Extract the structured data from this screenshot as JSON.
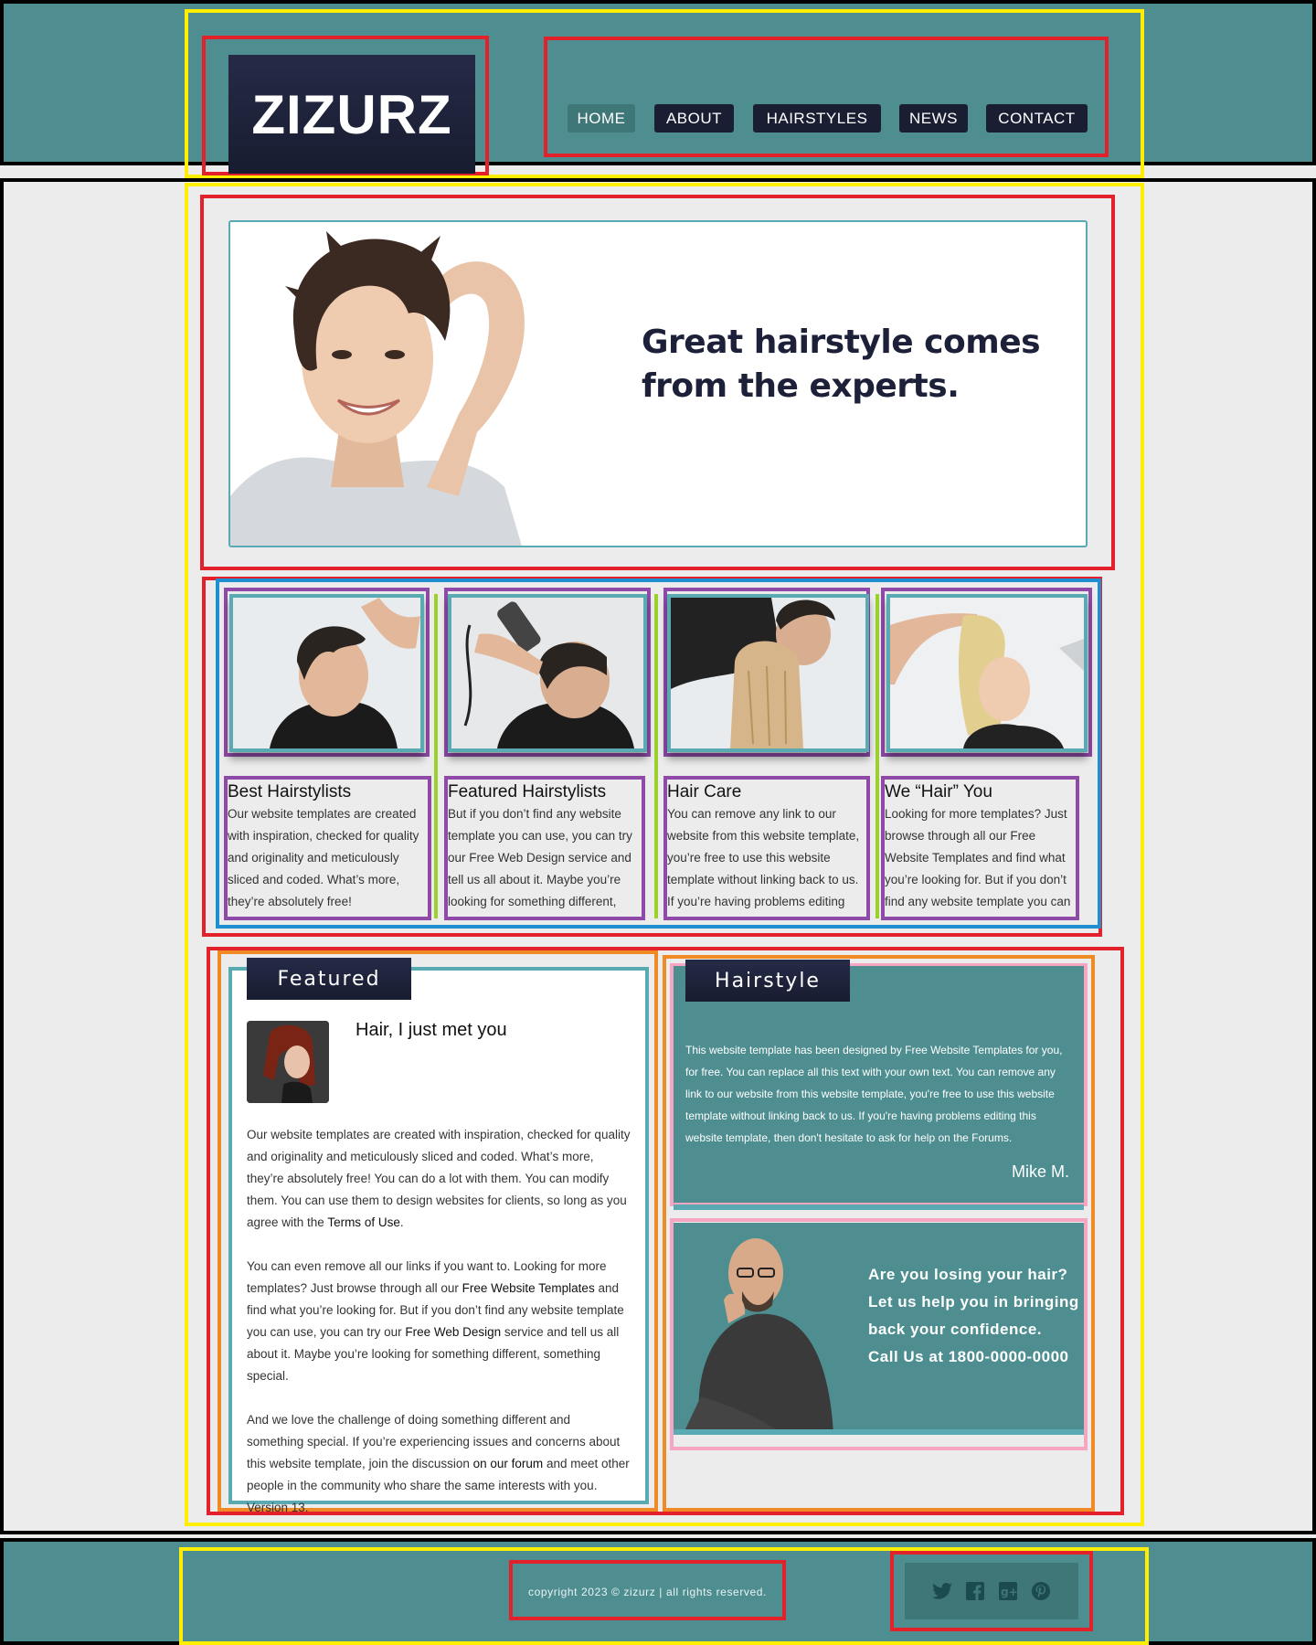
{
  "header": {
    "logo": "ZIZURZ",
    "nav": [
      {
        "label": "HOME",
        "active": true
      },
      {
        "label": "ABOUT",
        "active": false
      },
      {
        "label": "HAIRSTYLES",
        "active": false
      },
      {
        "label": "NEWS",
        "active": false
      },
      {
        "label": "CONTACT",
        "active": false
      }
    ]
  },
  "banner": {
    "headline_line1": "Great hairstyle comes",
    "headline_line2": "from the experts."
  },
  "features": [
    {
      "title": "Best Hairstylists",
      "text": "Our website templates are created with inspiration, checked for quality and originality and meticulously sliced and coded. What’s more, they’re absolutely free!"
    },
    {
      "title": "Featured Hairstylists",
      "text": "But if you don’t find any website template you can use, you can try our Free Web Design service and tell us all about it. Maybe you’re looking for something different, something"
    },
    {
      "title": "Hair Care",
      "text": "You can remove any link to our website from this website template, you’re free to use this website template without linking back to us. If you’re having problems editing this"
    },
    {
      "title": "We “Hair” You",
      "text": "Looking for more templates? Just browse through all our Free Website Templates and find what you’re looking for. But if you don’t find any website template you can use,"
    }
  ],
  "featured": {
    "tab": "Featured",
    "title": "Hair, I just met you",
    "p1_before": "Our website templates are created with inspiration, checked for quality and originality and meticulously sliced and coded. What’s more, they’re absolutely free! You can do a lot with them. You can modify them. You can use them to design websites for clients, so long as you agree with the ",
    "p1_link": "Terms of Use",
    "p1_after": ".",
    "p2_before": "You can even remove all our links if you want to. Looking for more templates? Just browse through all our ",
    "p2_link1": "Free Website Templates",
    "p2_mid": " and find what you’re looking for. But if you don’t find any website template you can use, you can try our ",
    "p2_link2": "Free Web Design",
    "p2_after": " service and tell us all about it. Maybe you’re looking for something different, something special.",
    "p3_before": "And we love the challenge of doing something different and something special. If you’re experiencing issues and concerns about this website template, join the discussion ",
    "p3_link": "on our forum",
    "p3_after": " and meet other people in the community who share the same interests with you. Version 13."
  },
  "hairstyle": {
    "tab": "Hairstyle",
    "text": "This website template has been designed by Free Website Templates for you, for free. You can replace all this text with your own text. You can remove any link to our website from this website template, you're free to use this website template without linking back to us. If you're having problems editing this website template, then don't hesitate to ask for help on the Forums.",
    "author": "Mike M."
  },
  "promo": {
    "line1": "Are you losing your hair?",
    "line2": "Let us help you in bringing",
    "line3": "back your confidence.",
    "line4": "Call Us at 1800-0000-0000"
  },
  "footer": {
    "copyright": "copyright 2023 © zizurz | all rights reserved.",
    "social": [
      "twitter-icon",
      "facebook-icon",
      "google-plus-icon",
      "pinterest-icon"
    ]
  },
  "colors": {
    "teal": "#4e8e91",
    "navy": "#1a1e33",
    "page_bg": "#ececec"
  }
}
